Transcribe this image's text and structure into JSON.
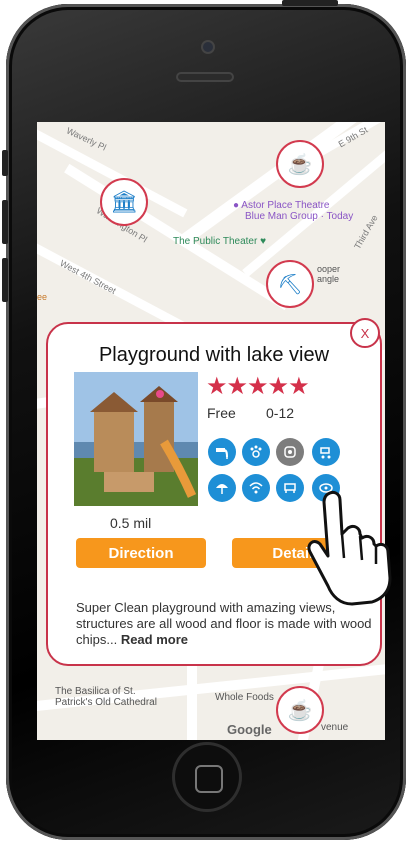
{
  "map": {
    "streets": [
      "Waverly Pl",
      "Washington Pl",
      "West 4th Street",
      "E 9th St",
      "Third Ave"
    ],
    "pois": {
      "astor": "Astor Place Theatre",
      "astor_sub": "Blue Man Group · Today",
      "public_theater": "The Public Theater",
      "cooper": "ooper",
      "cooper2": "angle",
      "basilica": "The Basilica of St.",
      "basilica2": "Patrick's Old Cathedral",
      "whole_foods": "Whole Foods",
      "avenue": "venue",
      "google": "Google",
      "left_cafe": "ee"
    }
  },
  "card": {
    "title": "Playground with lake view",
    "stars": "★★★★★",
    "rating": 5,
    "price": "Free",
    "age_range": "0-12",
    "distance": "0.5 mil",
    "direction_label": "Direction",
    "details_label": "Details",
    "description": "Super Clean playground with amazing views, structures are all wood and floor is made with wood chips...",
    "read_more": "Read more",
    "close_label": "X",
    "amenities": [
      "water-fountain-icon",
      "pet-friendly-icon",
      "restroom-icon",
      "stroller-icon",
      "shade-icon",
      "wifi-icon",
      "bench-icon",
      "parking-icon"
    ]
  },
  "colors": {
    "accent": "#c8334a",
    "button": "#f7971c",
    "amenity": "#1e8fd6",
    "marker_fill": "#1e7fc8"
  }
}
